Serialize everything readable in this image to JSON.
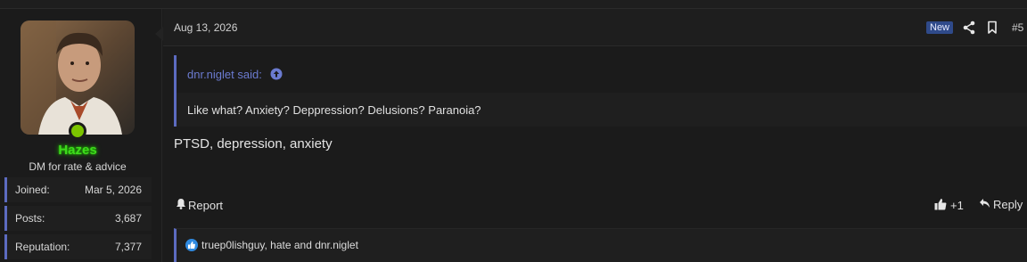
{
  "user": {
    "name": "Hazes",
    "title": "DM for rate & advice",
    "name_color": "#3edb1d",
    "online_color": "#7cc400",
    "stats": [
      {
        "label": "Joined:",
        "value": "Mar 5, 2026"
      },
      {
        "label": "Posts:",
        "value": "3,687"
      },
      {
        "label": "Reputation:",
        "value": "7,377"
      }
    ]
  },
  "post": {
    "date": "Aug 13, 2026",
    "badge": "New",
    "number": "#5",
    "quote": {
      "author_label": "dnr.niglet said:",
      "text": "Like what? Anxiety? Deppression? Delusions? Paranoia?"
    },
    "text": "PTSD, depression, anxiety",
    "actions": {
      "report": "Report",
      "like_count": "+1",
      "reply": "Reply"
    },
    "reactions_text": "truep0lishguy, hate and dnr.niglet"
  },
  "colors": {
    "accent": "#5c6bc0",
    "quote_author": "#6b7bd0",
    "badge_bg": "#2f4a8a",
    "like_badge": "#2f8ae0"
  },
  "icons": {
    "share": "share-icon",
    "bookmark": "bookmark-icon",
    "quote_jump": "arrow-up-circle-icon",
    "report": "bell-icon",
    "like": "thumbs-up-icon",
    "reply": "reply-icon",
    "reaction": "like-reaction-icon"
  }
}
